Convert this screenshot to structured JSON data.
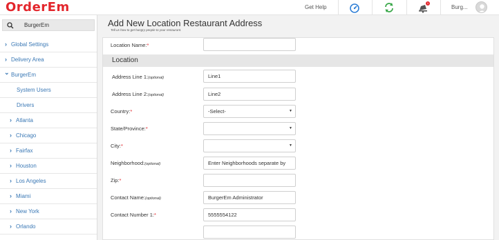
{
  "app": {
    "logo": "OrderEm"
  },
  "topbar": {
    "help": "Get Help",
    "notification_count": "1",
    "user_name": "Burg...",
    "icons": [
      "dashboard-icon",
      "refresh-icon",
      "notification-icon",
      "avatar"
    ]
  },
  "sidebar": {
    "search_value": "BurgerEm",
    "items": [
      {
        "label": "Global Settings",
        "chevron": "›",
        "kind": "collapsed"
      },
      {
        "label": "Delivery Area",
        "chevron": "›",
        "kind": "collapsed"
      },
      {
        "label": "BurgerEm",
        "chevron": "⌄",
        "kind": "expanded"
      },
      {
        "label": "System Users",
        "chevron": "",
        "kind": "child"
      },
      {
        "label": "Drivers",
        "chevron": "",
        "kind": "child"
      },
      {
        "label": "Atlanta",
        "chevron": "›",
        "kind": "location"
      },
      {
        "label": "Chicago",
        "chevron": "›",
        "kind": "location"
      },
      {
        "label": "Fairfax",
        "chevron": "›",
        "kind": "location"
      },
      {
        "label": "Houston",
        "chevron": "›",
        "kind": "location"
      },
      {
        "label": "Los Angeles",
        "chevron": "›",
        "kind": "location"
      },
      {
        "label": "Miami",
        "chevron": "›",
        "kind": "location"
      },
      {
        "label": "New York",
        "chevron": "›",
        "kind": "location"
      },
      {
        "label": "Orlando",
        "chevron": "›",
        "kind": "location"
      }
    ]
  },
  "main": {
    "title": "Add New Location Restaurant Address",
    "subtitle": "Tell us how to get hungry people to your restaurant.",
    "section_title": "Location",
    "fields": {
      "location_name": {
        "label": "Location Name:",
        "req": "*",
        "value": ""
      },
      "address1": {
        "label": "Address Line 1:",
        "opt": "(optional)",
        "value": "Line1"
      },
      "address2": {
        "label": "Address Line 2:",
        "opt": "(optional)",
        "value": "Line2"
      },
      "country": {
        "label": "Country:",
        "req": "*",
        "value": "-Select-"
      },
      "state": {
        "label": "State/Province:",
        "req": "*",
        "value": ""
      },
      "city": {
        "label": "City:",
        "req": "*",
        "value": ""
      },
      "neighborhood": {
        "label": "Neighborhood:",
        "opt": "(optional)",
        "value": "Enter Neighborhoods separate by"
      },
      "zip": {
        "label": "Zip:",
        "req": "*",
        "value": ""
      },
      "contact_name": {
        "label": "Contact Name:",
        "opt": "(optional)",
        "value": "BurgerEm Administrator"
      },
      "contact_number": {
        "label": "Contact Number 1:",
        "req": "*",
        "value": "5555554122"
      }
    },
    "select_arrow": "▼"
  },
  "colors": {
    "brand": "#e3262c",
    "link": "#3a78b5",
    "refresh": "#3aa84a",
    "dashboard": "#2f7fd6"
  }
}
